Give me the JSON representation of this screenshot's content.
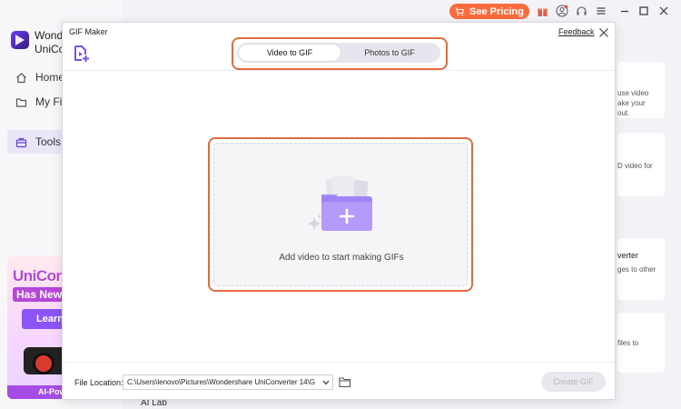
{
  "background_app": {
    "app_name": "Wondershare UniConverter",
    "app_name_visible": "Wonde UniCon",
    "nav": [
      {
        "label": "Home",
        "icon": "home-icon"
      },
      {
        "label": "My Fil",
        "icon": "files-icon"
      },
      {
        "label": "Tools",
        "icon": "toolbox-icon",
        "active": true
      }
    ],
    "promo": {
      "title": "UniConve",
      "subtitle": "Has Newly",
      "button": "Learn",
      "footer": "AI-Pow"
    },
    "topbar": {
      "pricing_label": "See Pricing",
      "icons": [
        "cart-icon",
        "gift-icon",
        "user-icon",
        "headset-icon",
        "menu-icon",
        "minimize-icon",
        "maximize-icon",
        "close-icon"
      ]
    },
    "cards": [
      {
        "lines": [
          "use video",
          "ake your",
          "out."
        ]
      },
      {
        "lines": [
          "D video for"
        ]
      },
      {
        "title": "verter",
        "lines": [
          "ges to other"
        ]
      },
      {
        "lines": [
          "files to"
        ]
      }
    ],
    "bottom_label": "AI Lab"
  },
  "modal": {
    "title": "GIF Maker",
    "feedback": "Feedback",
    "tabs": [
      {
        "label": "Video to GIF",
        "active": true
      },
      {
        "label": "Photos to GIF",
        "active": false
      }
    ],
    "drop_text": "Add video to start making GIFs",
    "file_location_label": "File Location:",
    "file_location_value": "C:\\Users\\lenovo\\Pictures\\Wondershare UniConverter 14\\G",
    "create_button": "Create GIF"
  },
  "colors": {
    "accent_purple": "#8b54f7",
    "highlight_orange": "#e06b3f",
    "pricing_orange": "#ff6b3d"
  }
}
